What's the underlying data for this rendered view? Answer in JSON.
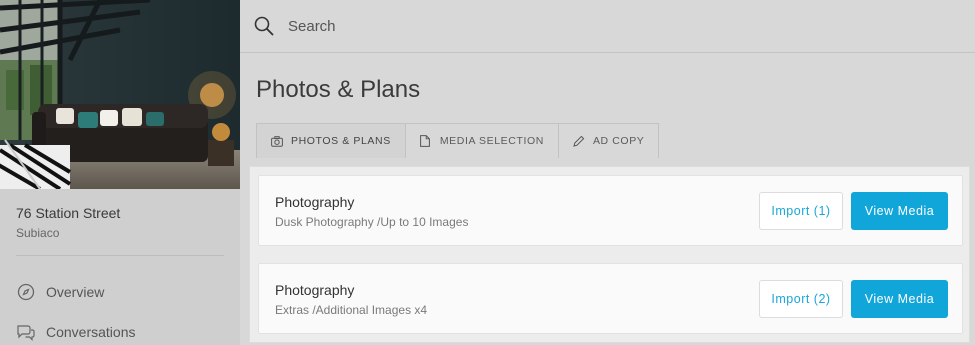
{
  "sidebar": {
    "property": {
      "address": "76 Station Street",
      "suburb": "Subiaco"
    },
    "nav": [
      {
        "label": "Overview",
        "icon": "compass-icon"
      },
      {
        "label": "Conversations",
        "icon": "chat-bubbles-icon"
      }
    ]
  },
  "search": {
    "placeholder": "Search",
    "value": ""
  },
  "page": {
    "title": "Photos & Plans"
  },
  "tabs": [
    {
      "label": "PHOTOS & PLANS",
      "icon": "camera-icon",
      "active": true
    },
    {
      "label": "MEDIA SELECTION",
      "icon": "document-icon",
      "active": false
    },
    {
      "label": "AD COPY",
      "icon": "pencil-icon",
      "active": false
    }
  ],
  "cards": [
    {
      "title": "Photography",
      "subtitle": "Dusk Photography /Up to 10 Images",
      "import_label": "Import (1)",
      "view_label": "View Media"
    },
    {
      "title": "Photography",
      "subtitle": "Extras /Additional Images x4",
      "import_label": "Import (2)",
      "view_label": "View Media"
    }
  ],
  "colors": {
    "accent": "#10a6da",
    "accent_text": "#1aa7d8"
  }
}
